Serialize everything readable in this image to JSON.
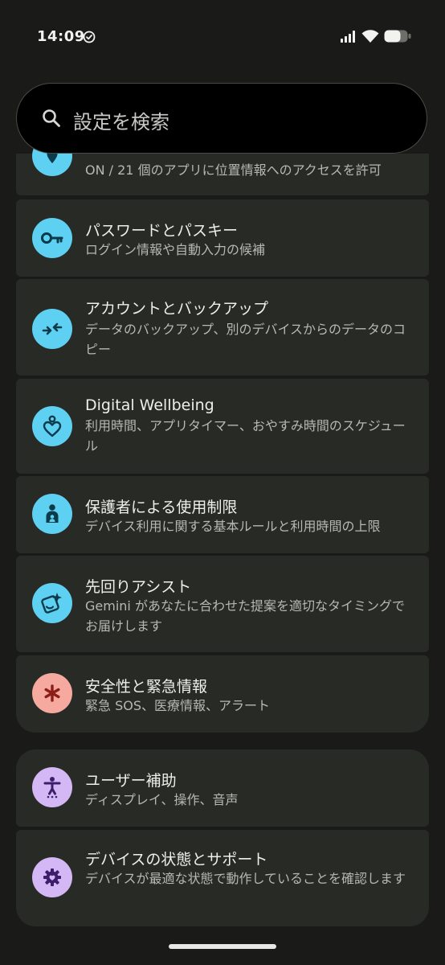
{
  "status_bar": {
    "time": "14:09",
    "icons": [
      "check-circle-icon",
      "signal-icon",
      "wifi-icon",
      "battery-icon"
    ]
  },
  "search": {
    "placeholder": "設定を検索",
    "icon": "search-icon"
  },
  "colors": {
    "background": "#1a1b18",
    "card": "#282a26",
    "accent_blue": "#5ed0f2",
    "accent_red": "#f5a99f",
    "accent_purple": "#d4b8f5"
  },
  "items": [
    {
      "icon": "location-icon",
      "title": "",
      "subtitle": "ON / 21 個のアプリに位置情報へのアクセスを許可"
    },
    {
      "icon": "key-icon",
      "title": "パスワードとパスキー",
      "subtitle": "ログイン情報や自動入力の候補"
    },
    {
      "icon": "backup-arrows-icon",
      "title": "アカウントとバックアップ",
      "subtitle": "データのバックアップ、別のデバイスからのデータのコピー"
    },
    {
      "icon": "wellbeing-heart-icon",
      "title": "Digital Wellbeing",
      "subtitle": "利用時間、アプリタイマー、おやすみ時間のスケジュール"
    },
    {
      "icon": "parental-controls-icon",
      "title": "保護者による使用制限",
      "subtitle": "デバイス利用に関する基本ルールと利用時間の上限"
    },
    {
      "icon": "sparkle-assist-icon",
      "title": "先回りアシスト",
      "subtitle": "Gemini があなたに合わせた提案を適切なタイミングでお届けします"
    },
    {
      "icon": "asterisk-emergency-icon",
      "title": "安全性と緊急情報",
      "subtitle": "緊急 SOS、医療情報、アラート"
    },
    {
      "icon": "accessibility-icon",
      "title": "ユーザー補助",
      "subtitle": "ディスプレイ、操作、音声"
    },
    {
      "icon": "device-care-gear-icon",
      "title": "デバイスの状態とサポート",
      "subtitle": "デバイスが最適な状態で動作していることを確認します"
    }
  ]
}
